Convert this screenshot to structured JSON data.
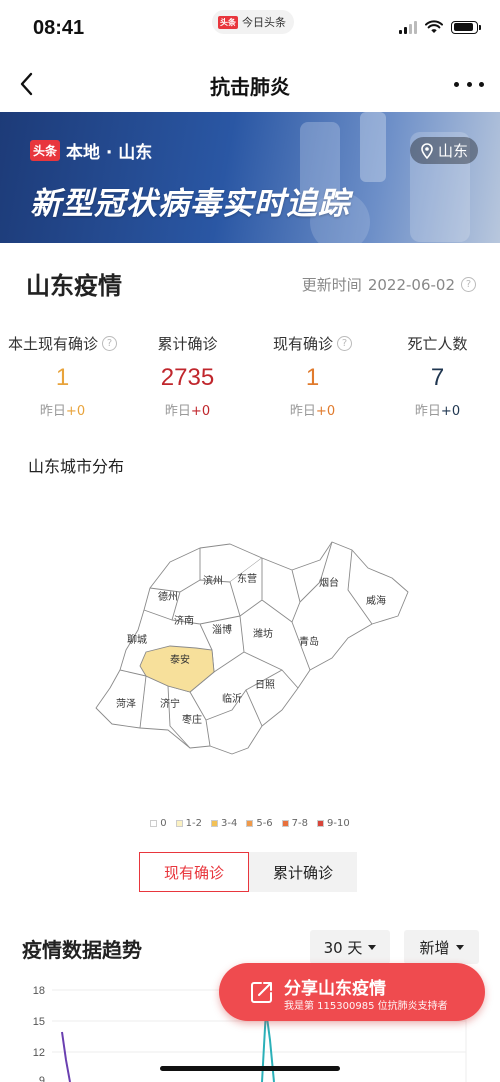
{
  "status": {
    "time": "08:41",
    "app_badge_logo": "头条",
    "app_name": "今日头条",
    "battery_level": 0.9
  },
  "nav": {
    "title": "抗击肺炎"
  },
  "banner": {
    "brand_logo": "头条",
    "brand_text": "本地 · 山东",
    "title": "新型冠状病毒实时追踪",
    "location": "山东"
  },
  "section": {
    "title": "山东疫情",
    "update_label": "更新时间",
    "update_date": "2022-06-02"
  },
  "stats": [
    {
      "label": "本土现有确诊",
      "value": "1",
      "delta_label": "昨日",
      "delta": "+0",
      "color": "#e8a33b",
      "delta_color": "#e8a33b",
      "help": true
    },
    {
      "label": "累计确诊",
      "value": "2735",
      "delta_label": "昨日",
      "delta": "+0",
      "color": "#c0262c",
      "delta_color": "#c0262c",
      "help": false
    },
    {
      "label": "现有确诊",
      "value": "1",
      "delta_label": "昨日",
      "delta": "+0",
      "color": "#e07a2c",
      "delta_color": "#e07a2c",
      "help": true
    },
    {
      "label": "死亡人数",
      "value": "7",
      "delta_label": "昨日",
      "delta": "+0",
      "color": "#1f3650",
      "delta_color": "#1f3650",
      "help": false
    }
  ],
  "map": {
    "title": "山东城市分布",
    "cities": [
      "滨州",
      "东营",
      "烟台",
      "德州",
      "威海",
      "济南",
      "淄博",
      "潍坊",
      "聊城",
      "青岛",
      "泰安",
      "日照",
      "菏泽",
      "济宁",
      "临沂",
      "枣庄"
    ],
    "highlighted_city": "泰安",
    "highlight_color": "#f7e09b"
  },
  "legend": [
    {
      "label": "0",
      "color": "#ffffff"
    },
    {
      "label": "1-2",
      "color": "#fbf1c2"
    },
    {
      "label": "3-4",
      "color": "#f2c156"
    },
    {
      "label": "5-6",
      "color": "#ef9a4b"
    },
    {
      "label": "7-8",
      "color": "#e8703c"
    },
    {
      "label": "9-10",
      "color": "#d8453a"
    }
  ],
  "toggle": {
    "active": "现有确诊",
    "inactive": "累计确诊"
  },
  "trend": {
    "title": "疫情数据趋势",
    "range_select": "30 天",
    "metric_select": "新增",
    "y_ticks": [
      "18",
      "15",
      "12",
      "9"
    ]
  },
  "share": {
    "title": "分享山东疫情",
    "subtitle": "我是第 115300985 位抗肺炎支持者"
  }
}
